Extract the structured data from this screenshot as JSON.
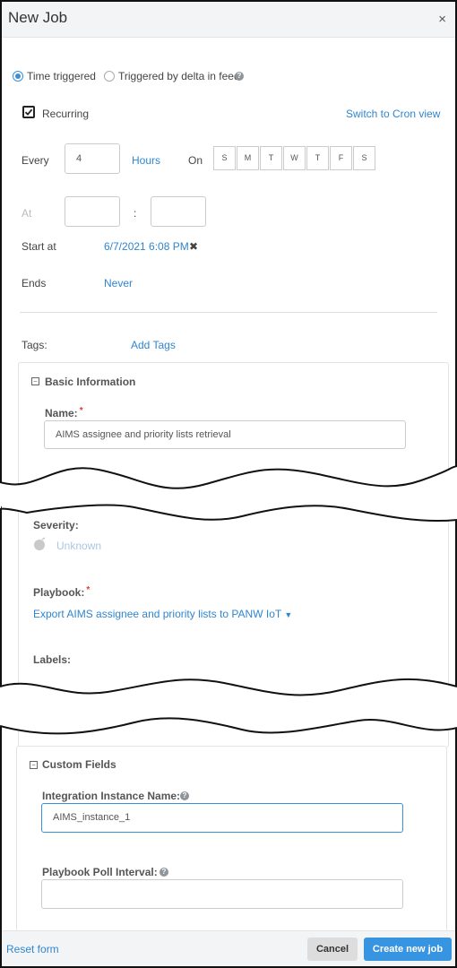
{
  "header": {
    "title": "New Job",
    "close": "×"
  },
  "trigger": {
    "time_label": "Time triggered",
    "delta_label": "Triggered by delta in feed",
    "help": "?"
  },
  "schedule": {
    "recurring_label": "Recurring",
    "cron_link": "Switch to Cron view",
    "every_label": "Every",
    "every_value": "4",
    "unit": "Hours",
    "on_label": "On",
    "days": [
      "S",
      "M",
      "T",
      "W",
      "T",
      "F",
      "S"
    ],
    "at_label": "At",
    "at_sep": ":",
    "start_label": "Start at",
    "start_value": "6/7/2021 6:08 PM",
    "start_clear": "✖",
    "ends_label": "Ends",
    "ends_value": "Never"
  },
  "tags": {
    "label": "Tags:",
    "add": "Add Tags"
  },
  "basic": {
    "title": "Basic Information",
    "toggle": "−",
    "name_label": "Name:",
    "name_value": "AIMS assignee and priority lists retrieval",
    "required": "*",
    "severity_label": "Severity:",
    "severity_value": "Unknown",
    "playbook_label": "Playbook:",
    "playbook_value": "Export AIMS assignee and priority lists to PANW IoT",
    "labels_label": "Labels:"
  },
  "custom": {
    "title": "Custom Fields",
    "toggle": "−",
    "instance_label": "Integration Instance Name:",
    "instance_value": "AIMS_instance_1",
    "poll_label": "Playbook Poll Interval:",
    "help": "?"
  },
  "footer": {
    "reset": "Reset form",
    "cancel": "Cancel",
    "create": "Create new job"
  }
}
